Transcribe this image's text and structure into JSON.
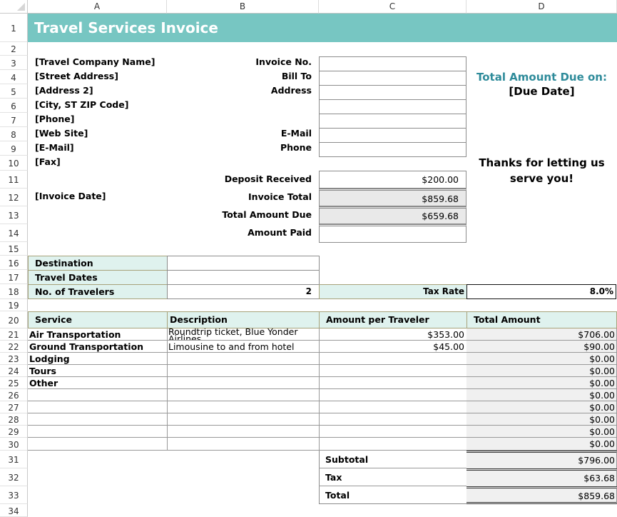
{
  "columns": [
    "A",
    "B",
    "C",
    "D"
  ],
  "rows": [
    "1",
    "2",
    "3",
    "4",
    "5",
    "6",
    "7",
    "8",
    "9",
    "10",
    "11",
    "12",
    "13",
    "14",
    "15",
    "16",
    "17",
    "18",
    "19",
    "20",
    "21",
    "22",
    "23",
    "24",
    "25",
    "26",
    "27",
    "28",
    "29",
    "30",
    "31",
    "32",
    "33",
    "34"
  ],
  "title": "Travel Services Invoice",
  "company": {
    "name": "[Travel Company Name]",
    "street": "[Street Address]",
    "address2": "[Address 2]",
    "city": "[City, ST  ZIP Code]",
    "phone": "[Phone]",
    "website": "[Web Site]",
    "email": "[E-Mail]",
    "fax": "[Fax]",
    "invoice_date": "[Invoice Date]"
  },
  "bill_fields": {
    "invoice_no_label": "Invoice No.",
    "bill_to_label": "Bill To",
    "address_label": "Address",
    "email_label": "E-Mail",
    "phone_label": "Phone",
    "invoice_no": "",
    "bill_to": "",
    "address1": "",
    "address2": "",
    "address3": "",
    "email": "",
    "phone": ""
  },
  "due": {
    "label": "Total Amount Due on:",
    "date": "[Due Date]",
    "color": "#2e8b9a"
  },
  "thanks": {
    "line1": "Thanks for letting us",
    "line2": "serve you!"
  },
  "summary": {
    "deposit_label": "Deposit Received",
    "deposit": "$200.00",
    "invoice_total_label": "Invoice Total",
    "invoice_total": "$859.68",
    "total_due_label": "Total Amount Due",
    "total_due": "$659.68",
    "amount_paid_label": "Amount Paid",
    "amount_paid": ""
  },
  "trip": {
    "destination_label": "Destination",
    "destination": "",
    "dates_label": "Travel Dates",
    "dates": "",
    "travelers_label": "No. of Travelers",
    "travelers": "2",
    "tax_rate_label": "Tax Rate",
    "tax_rate": "8.0%"
  },
  "services": {
    "headers": {
      "service": "Service",
      "description": "Description",
      "per_traveler": "Amount per Traveler",
      "total": "Total Amount"
    },
    "rows": [
      {
        "service": "Air Transportation",
        "description": "Roundtrip ticket, Blue Yonder Airlines",
        "per_traveler": "$353.00",
        "total": "$706.00"
      },
      {
        "service": "Ground Transportation",
        "description": "Limousine to and from hotel",
        "per_traveler": "$45.00",
        "total": "$90.00"
      },
      {
        "service": "Lodging",
        "description": "",
        "per_traveler": "",
        "total": "$0.00"
      },
      {
        "service": "Tours",
        "description": "",
        "per_traveler": "",
        "total": "$0.00"
      },
      {
        "service": "Other",
        "description": "",
        "per_traveler": "",
        "total": "$0.00"
      },
      {
        "service": "",
        "description": "",
        "per_traveler": "",
        "total": "$0.00"
      },
      {
        "service": "",
        "description": "",
        "per_traveler": "",
        "total": "$0.00"
      },
      {
        "service": "",
        "description": "",
        "per_traveler": "",
        "total": "$0.00"
      },
      {
        "service": "",
        "description": "",
        "per_traveler": "",
        "total": "$0.00"
      },
      {
        "service": "",
        "description": "",
        "per_traveler": "",
        "total": "$0.00"
      }
    ]
  },
  "totals": {
    "subtotal_label": "Subtotal",
    "subtotal": "$796.00",
    "tax_label": "Tax",
    "tax": "$63.68",
    "total_label": "Total",
    "total": "$859.68"
  }
}
